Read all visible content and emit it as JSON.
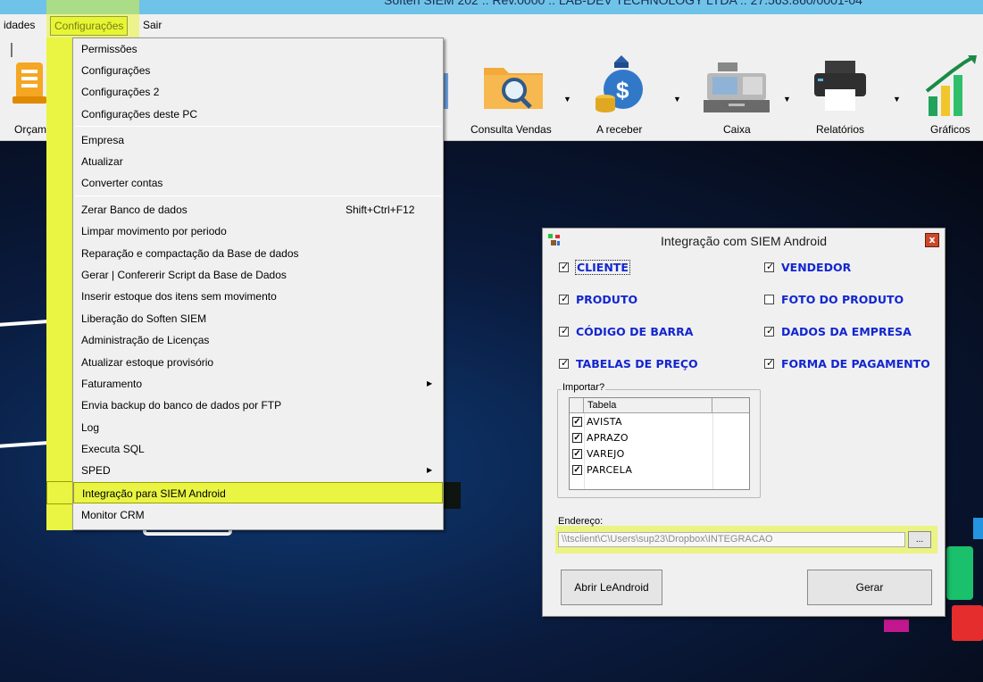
{
  "window": {
    "title": "Soften SIEM 202 :: Rev.0000 :: LAB-DEV TECHNOLOGY LTDA :: 27.563.860/0001-04"
  },
  "menubar": {
    "items": [
      "idades",
      "Configurações",
      "Sair"
    ]
  },
  "toolbar": {
    "buttons": [
      {
        "label": "Orçam",
        "icon": "budget-icon"
      },
      {
        "label": "Consulta Vendas",
        "icon": "folder-search-icon"
      },
      {
        "label": "A receber",
        "icon": "money-bag-icon"
      },
      {
        "label": "Caixa",
        "icon": "cash-register-icon"
      },
      {
        "label": "Relatórios",
        "icon": "printer-icon"
      },
      {
        "label": "Gráficos",
        "icon": "chart-icon"
      }
    ]
  },
  "menu": {
    "items": [
      {
        "label": "Permissões"
      },
      {
        "label": "Configurações"
      },
      {
        "label": "Configurações 2"
      },
      {
        "label": "Configurações deste PC"
      },
      {
        "label": "Empresa"
      },
      {
        "label": "Atualizar"
      },
      {
        "label": "Converter contas"
      },
      {
        "label": "Zerar Banco de dados",
        "shortcut": "Shift+Ctrl+F12"
      },
      {
        "label": "Limpar movimento por periodo"
      },
      {
        "label": "Reparação e compactação da Base de dados"
      },
      {
        "label": "Gerar | Confererir Script da Base de Dados"
      },
      {
        "label": "Inserir estoque dos itens sem movimento"
      },
      {
        "label": "Liberação do Soften SIEM"
      },
      {
        "label": "Administração de Licenças"
      },
      {
        "label": "Atualizar estoque provisório"
      },
      {
        "label": "Faturamento"
      },
      {
        "label": "Envia backup do banco de dados por FTP"
      },
      {
        "label": "Log"
      },
      {
        "label": "Executa SQL"
      },
      {
        "label": "SPED"
      },
      {
        "label": "Integração para SIEM Android"
      },
      {
        "label": "Monitor CRM"
      }
    ],
    "selected_label": "Integração para SIEM Android",
    "highlight_color": "#e9f542"
  },
  "dialog": {
    "title": "Integração com SIEM Android",
    "close_label": "x",
    "checkboxes": [
      {
        "label": "CLIENTE",
        "checked": true
      },
      {
        "label": "VENDEDOR",
        "checked": true
      },
      {
        "label": "PRODUTO",
        "checked": true
      },
      {
        "label": "FOTO DO PRODUTO",
        "checked": false
      },
      {
        "label": "CÓDIGO DE BARRA",
        "checked": true
      },
      {
        "label": "DADOS DA EMPRESA",
        "checked": true
      },
      {
        "label": "TABELAS DE PREÇO",
        "checked": true
      },
      {
        "label": "FORMA DE PAGAMENTO",
        "checked": true
      }
    ],
    "import_group": {
      "legend": "Importar?",
      "column_header": "Tabela",
      "rows": [
        {
          "name": "AVISTA",
          "checked": true
        },
        {
          "name": "APRAZO",
          "checked": true
        },
        {
          "name": "VAREJO",
          "checked": true
        },
        {
          "name": "PARCELA",
          "checked": true
        }
      ]
    },
    "address": {
      "label": "Endereço:",
      "value": "\\\\tsclient\\C\\Users\\sup23\\Dropbox\\INTEGRACAO",
      "browse_label": "..."
    },
    "buttons": {
      "open": "Abrir LeAndroid",
      "generate": "Gerar"
    },
    "label_color": "#1226cf"
  }
}
